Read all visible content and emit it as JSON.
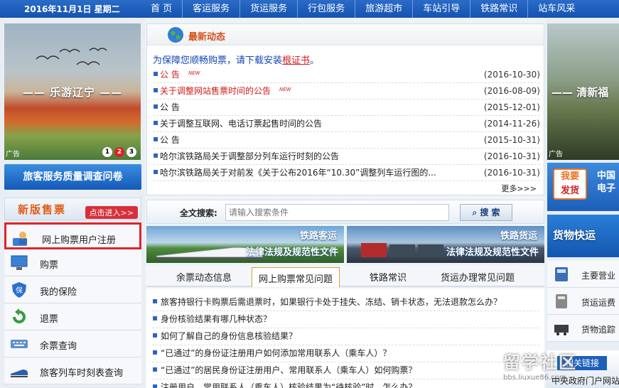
{
  "topbar": {
    "date": "2016年11月1日 星期二",
    "nav": [
      "首 页",
      "客运服务",
      "货运服务",
      "行包服务",
      "旅游超市",
      "车站引导",
      "铁路常识",
      "站车风采"
    ]
  },
  "left": {
    "ad": {
      "slogan": "—— 乐游辽宁 ——",
      "tag": "广告",
      "dots": [
        "1",
        "2",
        "3"
      ]
    },
    "survey_button": "旅客服务质量调查问卷",
    "new_sale": {
      "title": "新版售票",
      "enter": "点击进入>>"
    },
    "menu": [
      {
        "label": "网上购票用户注册",
        "icon": "user-register-icon"
      },
      {
        "label": "购票",
        "icon": "monitor-icon"
      },
      {
        "label": "我的保险",
        "icon": "shield-icon"
      },
      {
        "label": "退票",
        "icon": "return-icon"
      },
      {
        "label": "余票查询",
        "icon": "keyboard-icon"
      },
      {
        "label": "旅客列车时刻表查询",
        "icon": "train-icon"
      }
    ]
  },
  "news": {
    "title": "最新动态",
    "notice_text": "为保障您顺畅购票，请下载安装",
    "notice_link": "根证书",
    "notice_end": "。",
    "items": [
      {
        "text": "公 告",
        "date": "(2016-10-30)",
        "red": true,
        "is_new": true,
        "new_label": "NEW"
      },
      {
        "text": "关于调整网站售票时间的公告",
        "date": "(2016-08-09)",
        "red": true,
        "is_new": true,
        "new_label": "NEW"
      },
      {
        "text": "公 告",
        "date": "(2015-12-01)",
        "red": false,
        "is_new": false
      },
      {
        "text": "关于调整互联网、电话订票起售时间的公告",
        "date": "(2014-11-26)",
        "red": false,
        "is_new": false
      },
      {
        "text": "公 告",
        "date": "(2015-10-31)",
        "red": false,
        "is_new": false
      },
      {
        "text": "哈尔滨铁路局关于调整部分列车运行时刻的公告",
        "date": "(2016-10-31)",
        "red": false,
        "is_new": false
      },
      {
        "text": "哈尔滨铁路局关于对前发《关于公布2016年“10.30”调整列车运行图的...",
        "date": "(2016-10-31)",
        "red": false,
        "is_new": false
      }
    ],
    "more": "更多>>>"
  },
  "search": {
    "label": "全文搜索:",
    "placeholder": "请输入搜索条件",
    "button": "搜 索"
  },
  "banners": [
    {
      "cap1": "铁路客运",
      "cap2": "法律法规及规范性文件"
    },
    {
      "cap1": "铁路货运",
      "cap2": "法律法规及规范性文件"
    }
  ],
  "tabs": [
    "余票动态信息",
    "网上购票常见问题",
    "铁路常识",
    "货运办理常见问题"
  ],
  "active_tab": 1,
  "faq": [
    "旅客持银行卡购票后需退票时，如果银行卡处于挂失、冻结、销卡状态，无法退款怎么办？",
    "身份核验结果有哪几种状态？",
    "如何了解自己的身份信息核验结果？",
    "“已通过”的身份证注册用户如何添加常用联系人（乘车人）？",
    "“已通过”的居民身份证注册用户、常用联系人（乘车人）如何购票？",
    "注册用户、常用联系人（乘车人）核验结果为“待核验”时，怎么办？"
  ],
  "right": {
    "ad": {
      "slogan": "—— 清新福",
      "tag": "广告"
    },
    "promo1": {
      "line1": "我要",
      "line2": "发货",
      "side1": "中国",
      "side2": "电子"
    },
    "promo2": "货物快运",
    "list": [
      {
        "label": "主要营业",
        "icon": "phone-icon"
      },
      {
        "label": "货运运费",
        "icon": "calculator-icon"
      },
      {
        "label": "货物追踪",
        "icon": "locomotive-icon"
      }
    ],
    "bottom_button": "相关链接",
    "bottom_label": "中央政府门户网站"
  },
  "watermark": {
    "main": "留学社区",
    "sub": "bbs.liuxue86.com"
  },
  "colors": {
    "brand_blue": "#1553ae",
    "highlight_red": "#e0242c",
    "title_orange": "#d2521a"
  }
}
